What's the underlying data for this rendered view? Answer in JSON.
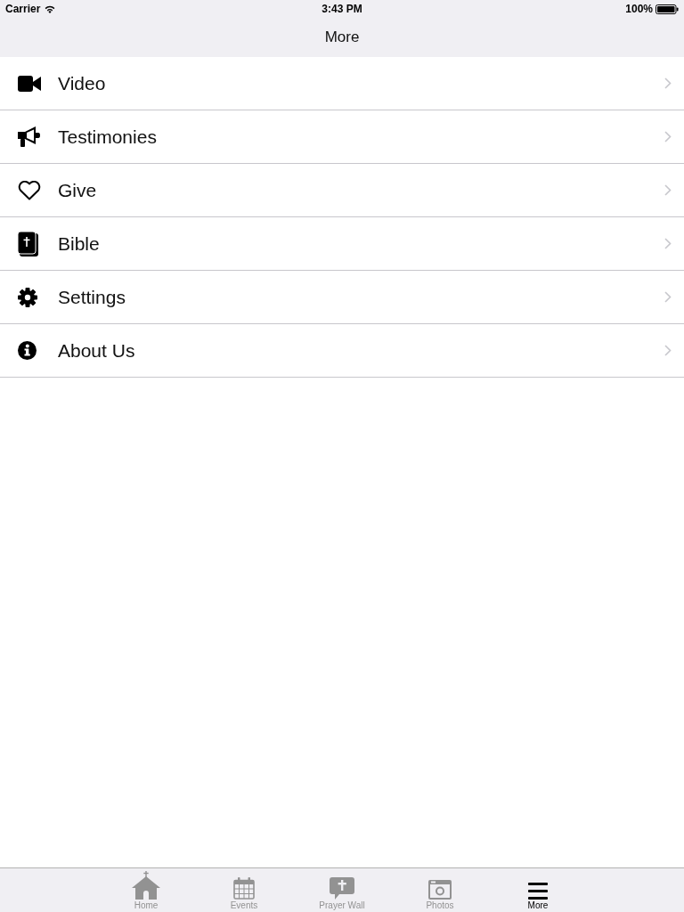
{
  "status_bar": {
    "carrier": "Carrier",
    "time": "3:43 PM",
    "battery": "100%"
  },
  "nav_bar": {
    "title": "More"
  },
  "menu": [
    {
      "label": "Video"
    },
    {
      "label": "Testimonies"
    },
    {
      "label": "Give"
    },
    {
      "label": "Bible"
    },
    {
      "label": "Settings"
    },
    {
      "label": "About Us"
    }
  ],
  "tab_bar": [
    {
      "label": "Home",
      "selected": false
    },
    {
      "label": "Events",
      "selected": false
    },
    {
      "label": "Prayer Wall",
      "selected": false
    },
    {
      "label": "Photos",
      "selected": false
    },
    {
      "label": "More",
      "selected": true
    }
  ]
}
